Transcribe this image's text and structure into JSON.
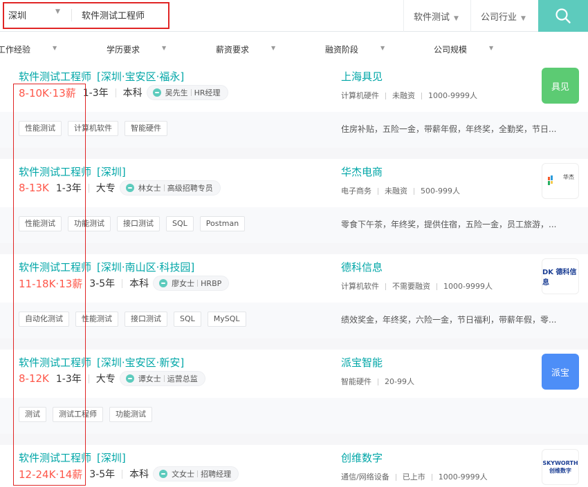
{
  "search": {
    "city": "深圳",
    "query": "软件测试工程师",
    "filters": [
      {
        "label": "软件测试"
      },
      {
        "label": "公司行业"
      }
    ]
  },
  "filter_row": [
    {
      "label": "工作经验"
    },
    {
      "label": "学历要求"
    },
    {
      "label": "薪资要求"
    },
    {
      "label": "融资阶段"
    },
    {
      "label": "公司规模"
    }
  ],
  "jobs": [
    {
      "title": "软件测试工程师",
      "location": "[深圳·宝安区·福永]",
      "salary": "8-10K·13薪",
      "experience": "1-3年",
      "education": "本科",
      "recruiter_name": "吴先生",
      "recruiter_role": "HR经理",
      "company": "上海具见",
      "industry": "计算机硬件",
      "funding": "未融资",
      "size": "1000-9999人",
      "logo_text": "具见",
      "logo_color": "#5ccb73",
      "tags": [
        "性能测试",
        "计算机软件",
        "智能硬件"
      ],
      "welfare": "住房补贴，五险一金，带薪年假，年终奖，全勤奖，节日..."
    },
    {
      "title": "软件测试工程师",
      "location": "[深圳]",
      "salary": "8-13K",
      "experience": "1-3年",
      "education": "大专",
      "recruiter_name": "林女士",
      "recruiter_role": "高级招聘专员",
      "company": "华杰电商",
      "industry": "电子商务",
      "funding": "未融资",
      "size": "500-999人",
      "logo_text": "华杰",
      "logo_color": "#ffffff",
      "tags": [
        "性能测试",
        "功能测试",
        "接口测试",
        "SQL",
        "Postman"
      ],
      "welfare": "零食下午茶，年终奖，提供住宿，五险一金，员工旅游，..."
    },
    {
      "title": "软件测试工程师",
      "location": "[深圳·南山区·科技园]",
      "salary": "11-18K·13薪",
      "experience": "3-5年",
      "education": "本科",
      "recruiter_name": "廖女士",
      "recruiter_role": "HRBP",
      "company": "德科信息",
      "industry": "计算机软件",
      "funding": "不需要融资",
      "size": "1000-9999人",
      "logo_text": "DK 德科信息",
      "logo_color": "#ffffff",
      "tags": [
        "自动化测试",
        "性能测试",
        "接口测试",
        "SQL",
        "MySQL"
      ],
      "welfare": "绩效奖金，年终奖，六险一金，节日福利，带薪年假，零..."
    },
    {
      "title": "软件测试工程师",
      "location": "[深圳·宝安区·新安]",
      "salary": "8-12K",
      "experience": "1-3年",
      "education": "大专",
      "recruiter_name": "谭女士",
      "recruiter_role": "运营总监",
      "company": "派宝智能",
      "industry": "智能硬件",
      "funding": "",
      "size": "20-99人",
      "logo_text": "派宝",
      "logo_color": "#4d8ef7",
      "tags": [
        "测试",
        "测试工程师",
        "功能测试"
      ],
      "welfare": ""
    },
    {
      "title": "软件测试工程师",
      "location": "[深圳]",
      "salary": "12-24K·14薪",
      "experience": "3-5年",
      "education": "本科",
      "recruiter_name": "文女士",
      "recruiter_role": "招聘经理",
      "company": "创维数字",
      "industry": "通信/网络设备",
      "funding": "已上市",
      "size": "1000-9999人",
      "logo_text": "SKYWORTH 创维数字",
      "logo_color": "#ffffff",
      "tags": [],
      "welfare": ""
    }
  ]
}
